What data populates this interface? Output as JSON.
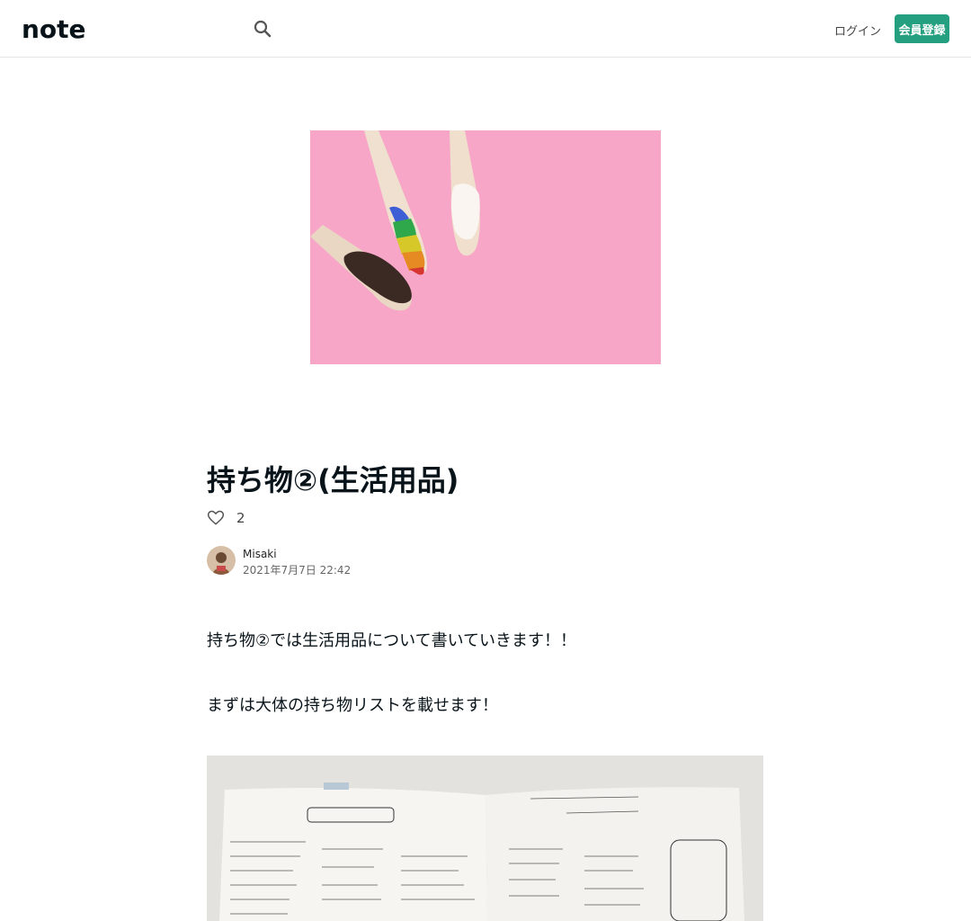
{
  "header": {
    "logo_text": "note",
    "search_icon": "search-icon",
    "login_label": "ログイン",
    "signup_label": "会員登録",
    "accent_color": "#249f80"
  },
  "article": {
    "title": "持ち物②(生活用品)",
    "like_icon": "heart-icon",
    "like_count": "2",
    "author_name": "Misaki",
    "post_date": "2021年7月7日 22:42",
    "paragraphs": [
      "持ち物②では生活用品について書いていきます！！",
      "まずは大体の持ち物リストを載せます！"
    ]
  }
}
